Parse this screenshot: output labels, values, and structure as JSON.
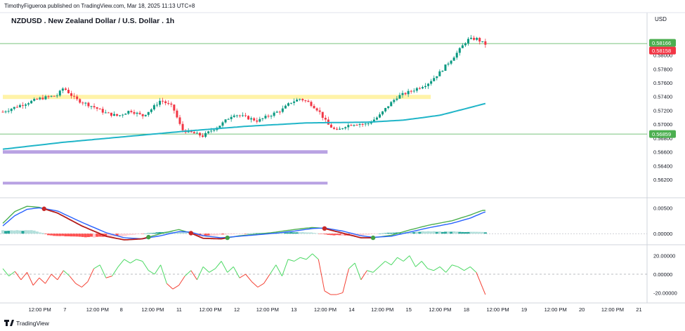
{
  "header": {
    "attribution": "TimothyFigueroa published on TradingView.com, Mar 18, 2025 11:13 UTC+8",
    "symbol_title": "NZDUSD . New Zealand Dollar / U.S. Dollar . 1h",
    "currency": "USD"
  },
  "footer": {
    "brand": "TradingView"
  },
  "colors": {
    "up": "#089981",
    "down": "#f23645",
    "ma": "#20b5c8",
    "supply_zone": "#fff3a8",
    "demand_zone": "#b9a3e3",
    "level_line": "#4caf50",
    "macd_fast": "#4caf50",
    "macd_slow": "#2962ff",
    "macd_dark": "#b71c1c",
    "rsi_up": "#4cd964",
    "rsi_down": "#f44336",
    "price_badge_green": "#4caf50",
    "price_badge_red": "#f23645"
  },
  "chart_data": [
    {
      "type": "candlestick",
      "title": "NZDUSD . New Zealand Dollar / U.S. Dollar . 1h",
      "y_tick_labels": [
        "0.58000",
        "0.57800",
        "0.57600",
        "0.57400",
        "0.57200",
        "0.57000",
        "0.56800",
        "0.56600",
        "0.56400",
        "0.56200"
      ],
      "ylim": [
        0.5608,
        0.5835
      ],
      "price_labels": [
        {
          "value": "0.58166",
          "color": "#4caf50"
        },
        {
          "value": "0.58158",
          "color": "#f23645"
        },
        {
          "value": "0.56859",
          "color": "#4caf50"
        }
      ],
      "horizontal_levels": [
        0.58166,
        0.56859
      ],
      "zones": [
        {
          "name": "supply",
          "from": 0.57365,
          "to": 0.57425,
          "x_start": 0,
          "x_end": 0.705
        },
        {
          "name": "demand",
          "from": 0.56575,
          "to": 0.56625,
          "x_start": 0,
          "x_end": 0.535
        },
        {
          "name": "demand",
          "from": 0.5613,
          "to": 0.5617,
          "x_start": 0,
          "x_end": 0.535
        }
      ],
      "close_anchors": [
        [
          0,
          0.5718
        ],
        [
          0.03,
          0.5728
        ],
        [
          0.06,
          0.5737
        ],
        [
          0.09,
          0.5742
        ],
        [
          0.1,
          0.5753
        ],
        [
          0.12,
          0.5736
        ],
        [
          0.15,
          0.5725
        ],
        [
          0.17,
          0.5716
        ],
        [
          0.19,
          0.5712
        ],
        [
          0.21,
          0.572
        ],
        [
          0.23,
          0.5712
        ],
        [
          0.245,
          0.5722
        ],
        [
          0.26,
          0.5735
        ],
        [
          0.28,
          0.5725
        ],
        [
          0.295,
          0.5692
        ],
        [
          0.31,
          0.5688
        ],
        [
          0.33,
          0.5683
        ],
        [
          0.345,
          0.5692
        ],
        [
          0.36,
          0.57
        ],
        [
          0.38,
          0.5715
        ],
        [
          0.4,
          0.571
        ],
        [
          0.42,
          0.5705
        ],
        [
          0.44,
          0.5713
        ],
        [
          0.46,
          0.5721
        ],
        [
          0.475,
          0.5732
        ],
        [
          0.49,
          0.5737
        ],
        [
          0.505,
          0.5731
        ],
        [
          0.52,
          0.572
        ],
        [
          0.535,
          0.57
        ],
        [
          0.55,
          0.569
        ],
        [
          0.565,
          0.5698
        ],
        [
          0.58,
          0.5701
        ],
        [
          0.6,
          0.57
        ],
        [
          0.62,
          0.5712
        ],
        [
          0.635,
          0.5727
        ],
        [
          0.65,
          0.574
        ],
        [
          0.67,
          0.5747
        ],
        [
          0.685,
          0.5753
        ],
        [
          0.7,
          0.5759
        ],
        [
          0.72,
          0.5775
        ],
        [
          0.735,
          0.579
        ],
        [
          0.75,
          0.5805
        ],
        [
          0.765,
          0.5822
        ],
        [
          0.78,
          0.5824
        ],
        [
          0.79,
          0.5818
        ],
        [
          0.795,
          0.58158
        ]
      ],
      "ma_anchors": [
        [
          0,
          0.5664
        ],
        [
          0.1,
          0.5674
        ],
        [
          0.2,
          0.5682
        ],
        [
          0.3,
          0.569
        ],
        [
          0.4,
          0.5697
        ],
        [
          0.5,
          0.5702
        ],
        [
          0.6,
          0.5703
        ],
        [
          0.66,
          0.5706
        ],
        [
          0.72,
          0.5713
        ],
        [
          0.76,
          0.5722
        ],
        [
          0.795,
          0.573
        ]
      ],
      "candle_count": 170
    },
    {
      "type": "line",
      "name": "MACD",
      "y_tick_labels": [
        "0.00500",
        "0.00000"
      ],
      "ylim": [
        -0.0016,
        0.0064
      ],
      "series": [
        {
          "color": "#4caf50",
          "anchors": [
            [
              0,
              0.002
            ],
            [
              0.02,
              0.0043
            ],
            [
              0.04,
              0.0053
            ],
            [
              0.06,
              0.0051
            ],
            [
              0.09,
              0.004
            ],
            [
              0.13,
              0.0015
            ],
            [
              0.17,
              -0.0005
            ],
            [
              0.2,
              -0.0012
            ],
            [
              0.23,
              -0.001
            ],
            [
              0.26,
              0.0
            ],
            [
              0.29,
              0.0008
            ],
            [
              0.31,
              0.0001
            ],
            [
              0.33,
              -0.0009
            ],
            [
              0.36,
              -0.001
            ],
            [
              0.39,
              -0.0004
            ],
            [
              0.42,
              -0.0001
            ],
            [
              0.45,
              0.0003
            ],
            [
              0.48,
              0.0008
            ],
            [
              0.51,
              0.0012
            ],
            [
              0.53,
              0.001
            ],
            [
              0.56,
              0.0001
            ],
            [
              0.59,
              -0.0008
            ],
            [
              0.61,
              -0.0008
            ],
            [
              0.64,
              -0.0003
            ],
            [
              0.67,
              0.0007
            ],
            [
              0.7,
              0.0016
            ],
            [
              0.74,
              0.0025
            ],
            [
              0.77,
              0.0036
            ],
            [
              0.79,
              0.0045
            ],
            [
              0.795,
              0.0045
            ]
          ]
        },
        {
          "color": "#2962ff",
          "anchors": [
            [
              0,
              0.0015
            ],
            [
              0.02,
              0.0035
            ],
            [
              0.04,
              0.0047
            ],
            [
              0.06,
              0.005
            ],
            [
              0.09,
              0.0044
            ],
            [
              0.13,
              0.0022
            ],
            [
              0.17,
              0.0002
            ],
            [
              0.2,
              -0.0008
            ],
            [
              0.23,
              -0.001
            ],
            [
              0.26,
              -0.0004
            ],
            [
              0.29,
              0.0004
            ],
            [
              0.31,
              0.0003
            ],
            [
              0.33,
              -0.0004
            ],
            [
              0.36,
              -0.0008
            ],
            [
              0.39,
              -0.0005
            ],
            [
              0.42,
              -0.0002
            ],
            [
              0.45,
              0.0001
            ],
            [
              0.48,
              0.0005
            ],
            [
              0.51,
              0.001
            ],
            [
              0.53,
              0.0011
            ],
            [
              0.56,
              0.0005
            ],
            [
              0.59,
              -0.0004
            ],
            [
              0.61,
              -0.0007
            ],
            [
              0.64,
              -0.0005
            ],
            [
              0.67,
              0.0003
            ],
            [
              0.7,
              0.0011
            ],
            [
              0.74,
              0.002
            ],
            [
              0.77,
              0.003
            ],
            [
              0.79,
              0.004
            ],
            [
              0.795,
              0.0042
            ]
          ]
        }
      ],
      "histogram_anchors": [
        [
          0,
          0.0006
        ],
        [
          0.05,
          0.0006
        ],
        [
          0.08,
          -0.0004
        ],
        [
          0.13,
          -0.0007
        ],
        [
          0.17,
          -0.0007
        ],
        [
          0.2,
          -0.0004
        ],
        [
          0.24,
          0.0001
        ],
        [
          0.27,
          0.0004
        ],
        [
          0.3,
          0.0002
        ],
        [
          0.33,
          -0.0005
        ],
        [
          0.36,
          -0.0002
        ],
        [
          0.42,
          0.0001
        ],
        [
          0.48,
          0.0003
        ],
        [
          0.51,
          0.0002
        ],
        [
          0.54,
          -0.0003
        ],
        [
          0.58,
          -0.0004
        ],
        [
          0.61,
          -0.0001
        ],
        [
          0.64,
          0.0002
        ],
        [
          0.69,
          0.0004
        ],
        [
          0.74,
          0.0004
        ],
        [
          0.79,
          0.0003
        ],
        [
          0.795,
          0.0003
        ]
      ],
      "cross_markers": [
        [
          0.068,
          "red"
        ],
        [
          0.31,
          "red"
        ],
        [
          0.24,
          "green"
        ],
        [
          0.37,
          "green"
        ],
        [
          0.53,
          "red"
        ],
        [
          0.61,
          "green"
        ]
      ]
    },
    {
      "type": "line",
      "name": "RSI",
      "y_tick_labels": [
        "20.00000",
        "0.00000",
        "-20.00000"
      ],
      "ylim": [
        -28,
        28
      ],
      "series_anchors": [
        [
          0,
          6
        ],
        [
          0.01,
          -2
        ],
        [
          0.02,
          3
        ],
        [
          0.03,
          -6
        ],
        [
          0.04,
          2
        ],
        [
          0.05,
          -12
        ],
        [
          0.06,
          -4
        ],
        [
          0.07,
          -10
        ],
        [
          0.08,
          0
        ],
        [
          0.09,
          -6
        ],
        [
          0.1,
          4
        ],
        [
          0.11,
          -2
        ],
        [
          0.12,
          -10
        ],
        [
          0.13,
          -14
        ],
        [
          0.14,
          -8
        ],
        [
          0.15,
          6
        ],
        [
          0.16,
          10
        ],
        [
          0.17,
          -4
        ],
        [
          0.18,
          -2
        ],
        [
          0.19,
          8
        ],
        [
          0.2,
          16
        ],
        [
          0.21,
          12
        ],
        [
          0.22,
          16
        ],
        [
          0.23,
          14
        ],
        [
          0.24,
          4
        ],
        [
          0.25,
          0
        ],
        [
          0.26,
          10
        ],
        [
          0.27,
          -10
        ],
        [
          0.28,
          -16
        ],
        [
          0.29,
          -12
        ],
        [
          0.3,
          -2
        ],
        [
          0.31,
          4
        ],
        [
          0.32,
          -6
        ],
        [
          0.33,
          8
        ],
        [
          0.34,
          2
        ],
        [
          0.35,
          6
        ],
        [
          0.36,
          14
        ],
        [
          0.37,
          2
        ],
        [
          0.38,
          8
        ],
        [
          0.39,
          -4
        ],
        [
          0.4,
          0
        ],
        [
          0.41,
          -8
        ],
        [
          0.42,
          -14
        ],
        [
          0.43,
          -10
        ],
        [
          0.44,
          0
        ],
        [
          0.45,
          10
        ],
        [
          0.46,
          -2
        ],
        [
          0.47,
          16
        ],
        [
          0.48,
          14
        ],
        [
          0.49,
          18
        ],
        [
          0.5,
          16
        ],
        [
          0.51,
          22
        ],
        [
          0.52,
          16
        ],
        [
          0.53,
          -18
        ],
        [
          0.54,
          -22
        ],
        [
          0.55,
          -22
        ],
        [
          0.56,
          -20
        ],
        [
          0.57,
          6
        ],
        [
          0.58,
          12
        ],
        [
          0.59,
          -6
        ],
        [
          0.6,
          4
        ],
        [
          0.61,
          2
        ],
        [
          0.62,
          8
        ],
        [
          0.63,
          14
        ],
        [
          0.64,
          10
        ],
        [
          0.65,
          18
        ],
        [
          0.66,
          14
        ],
        [
          0.67,
          20
        ],
        [
          0.68,
          8
        ],
        [
          0.69,
          14
        ],
        [
          0.7,
          6
        ],
        [
          0.71,
          4
        ],
        [
          0.72,
          8
        ],
        [
          0.73,
          2
        ],
        [
          0.74,
          10
        ],
        [
          0.75,
          8
        ],
        [
          0.76,
          4
        ],
        [
          0.77,
          8
        ],
        [
          0.78,
          2
        ],
        [
          0.79,
          -14
        ],
        [
          0.795,
          -22
        ]
      ]
    }
  ],
  "x_axis": {
    "labels": [
      {
        "text": "12:00 PM",
        "pos": 0.05
      },
      {
        "text": "7",
        "pos": 0.09
      },
      {
        "text": "12:00 PM",
        "pos": 0.142
      },
      {
        "text": "8",
        "pos": 0.18
      },
      {
        "text": "12:00 PM",
        "pos": 0.23
      },
      {
        "text": "11",
        "pos": 0.272
      },
      {
        "text": "12:00 PM",
        "pos": 0.322
      },
      {
        "text": "12",
        "pos": 0.364
      },
      {
        "text": "12:00 PM",
        "pos": 0.413
      },
      {
        "text": "13",
        "pos": 0.455
      },
      {
        "text": "12:00 PM",
        "pos": 0.505
      },
      {
        "text": "14",
        "pos": 0.547
      },
      {
        "text": "12:00 PM",
        "pos": 0.596
      },
      {
        "text": "15",
        "pos": 0.638
      },
      {
        "text": "12:00 PM",
        "pos": 0.688
      },
      {
        "text": "18",
        "pos": 0.73
      },
      {
        "text": "12:00 PM",
        "pos": 0.78
      },
      {
        "text": "19",
        "pos": 0.822
      },
      {
        "text": "12:00 PM",
        "pos": 0.872
      },
      {
        "text": "20",
        "pos": 0.914
      },
      {
        "text": "12:00 PM",
        "pos": 0.963
      },
      {
        "text": "21",
        "pos": 1.005
      }
    ]
  }
}
